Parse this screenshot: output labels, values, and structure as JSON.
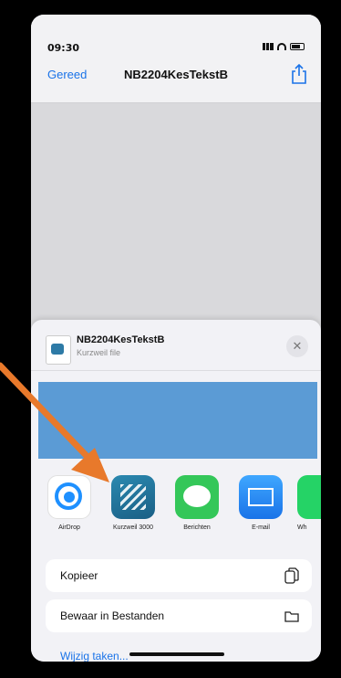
{
  "status": {
    "time": "09:30"
  },
  "nav": {
    "done_label": "Gereed",
    "title": "NB2204KesTekstB"
  },
  "sheet": {
    "file_name": "NB2204KesTekstB",
    "file_type": "Kurzweil file",
    "apps": [
      {
        "label": "AirDrop",
        "icon": "airdrop-icon"
      },
      {
        "label": "Kurzweil 3000",
        "icon": "kurzweil-icon"
      },
      {
        "label": "Berichten",
        "icon": "messages-icon"
      },
      {
        "label": "E-mail",
        "icon": "mail-icon"
      },
      {
        "label": "Wh",
        "icon": "whatsapp-icon"
      }
    ],
    "actions": [
      {
        "label": "Kopieer",
        "icon": "copy-icon"
      },
      {
        "label": "Bewaar in Bestanden",
        "icon": "folder-icon"
      }
    ],
    "edit_actions_label": "Wijzig taken..."
  },
  "colors": {
    "accent": "#1a73e8",
    "preview": "#5b9bd5",
    "arrow": "#e8792b"
  }
}
